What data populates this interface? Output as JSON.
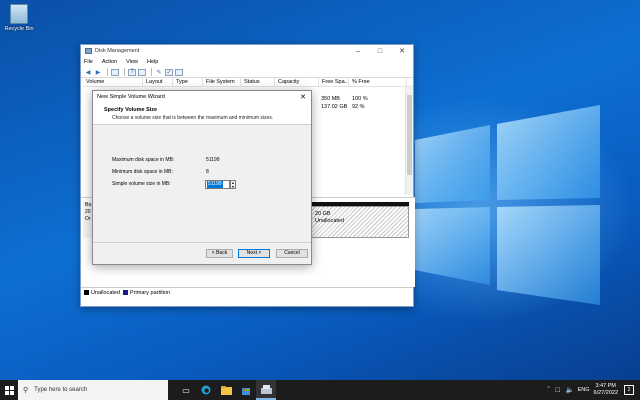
{
  "desktop": {
    "recycle_bin_label": "Recycle Bin"
  },
  "disk_management": {
    "title": "Disk Management",
    "menu": [
      "File",
      "Action",
      "View",
      "Help"
    ],
    "columns": [
      "Volume",
      "Layout",
      "Type",
      "File System",
      "Status",
      "Capacity",
      "Free Spa...",
      "% Free"
    ],
    "rows": [
      {
        "free": "350 MB",
        "pct": "100 %"
      },
      {
        "free": "137.02 GB",
        "pct": "92 %"
      }
    ],
    "disk_label_lines": [
      "Ba",
      "20",
      "Or"
    ],
    "unallocated_size": "20 GB",
    "unallocated_label": "Unallocated",
    "legend": {
      "unallocated": "Unallocated",
      "primary": "Primary partition"
    }
  },
  "wizard": {
    "title": "New Simple Volume Wizard",
    "heading": "Specify Volume Size",
    "subheading": "Choose a volume size that is between the maximum and minimum sizes.",
    "max_label": "Maximum disk space in MB:",
    "max_value": "51199",
    "min_label": "Minimum disk space in MB:",
    "min_value": "8",
    "size_label": "Simple volume size in MB:",
    "size_value": "51199",
    "back_label": "< Back",
    "next_label": "Next >",
    "cancel_label": "Cancel"
  },
  "taskbar": {
    "search_placeholder": "Type here to search",
    "language": "ENG",
    "time": "3:47 PM",
    "date": "6/27/2022",
    "notification_count": "2"
  },
  "colors": {
    "accent": "#0078d7",
    "taskbar": "#1c1c1c",
    "desktop": "#0b5fc0"
  }
}
